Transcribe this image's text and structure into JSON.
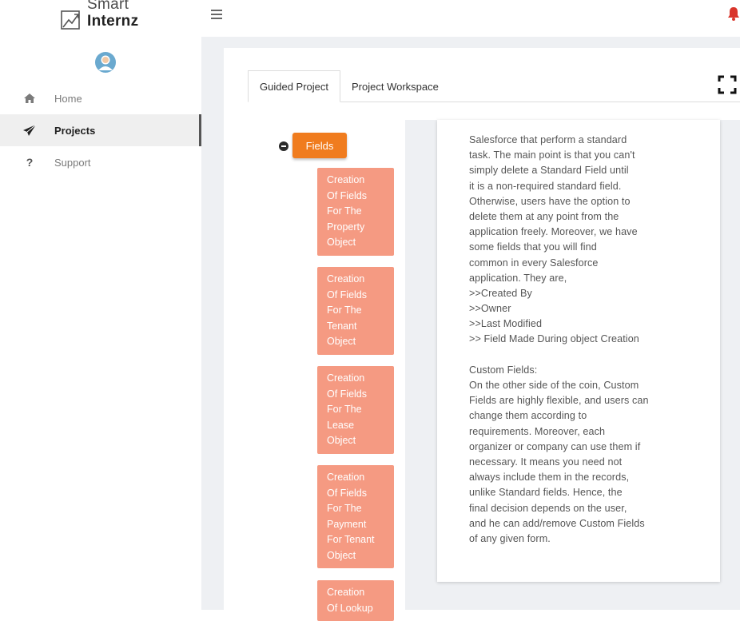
{
  "brand": {
    "line1": "Smart",
    "line2": "Internz"
  },
  "sidebar": {
    "items": [
      {
        "label": "Home",
        "icon": "home-icon",
        "active": false
      },
      {
        "label": "Projects",
        "icon": "paper-plane-icon",
        "active": true
      },
      {
        "label": "Support",
        "icon": "question-icon",
        "active": false
      }
    ]
  },
  "tabs": [
    {
      "label": "Guided Project",
      "active": true
    },
    {
      "label": "Project Workspace",
      "active": false
    }
  ],
  "tree": {
    "root": "Fields",
    "children": [
      "Creation\nOf Fields\nFor The\nProperty\nObject",
      "Creation\nOf Fields\nFor The\nTenant\nObject",
      "Creation\nOf Fields\nFor The\nLease\nObject",
      "Creation\nOf Fields\nFor The\nPayment\nFor Tenant\nObject",
      "Creation\nOf Lookup"
    ]
  },
  "content": {
    "lines": [
      "Salesforce that perform a standard",
      "task. The main point is that you can't",
      "simply delete a Standard Field until",
      "it is a non-required standard field.",
      "Otherwise, users have the option to",
      "delete them at any point from the",
      "application freely. Moreover, we have",
      "some fields that you will find",
      "common in every Salesforce",
      "application. They are,",
      ">>Created By",
      ">>Owner",
      ">>Last Modified",
      ">> Field Made During object Creation",
      "",
      "Custom Fields:",
      "On the other side of the coin, Custom",
      "Fields are highly flexible, and users can",
      "change them according to",
      "requirements. Moreover, each",
      "organizer or company can use them if",
      "necessary. It means you need not",
      "always include them in the records,",
      "unlike Standard fields. Hence, the",
      "final decision depends on the user,",
      "and he can add/remove Custom Fields",
      "of any given form."
    ]
  },
  "colors": {
    "accent_orange": "#f07c1e",
    "node_salmon": "#f59a82",
    "bell_red": "#d9352b"
  }
}
